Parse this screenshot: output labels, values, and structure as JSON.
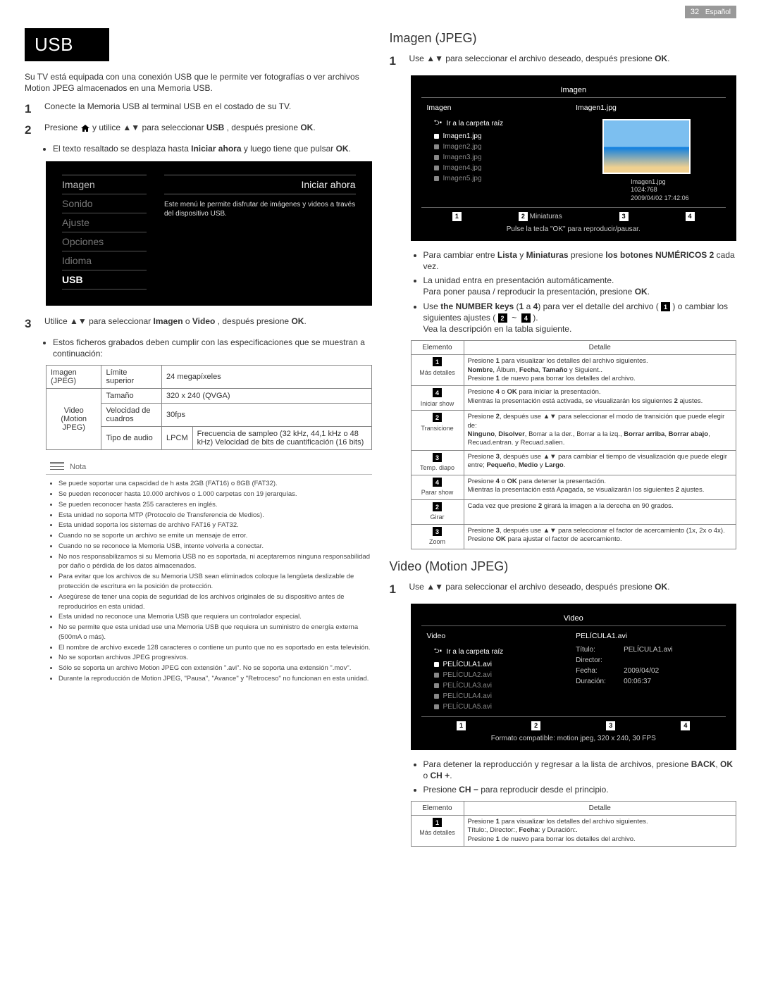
{
  "header": {
    "page": "32",
    "lang": "Español"
  },
  "left": {
    "title": "USB",
    "intro": "Su TV está equipada con una conexión USB que le permite ver fotografías o ver archivos Motion JPEG almacenados en una Memoria USB.",
    "step1": "Conecte la Memoria USB al terminal USB en el costado de su TV.",
    "step2_pre": "Presione ",
    "step2_mid": " y utilice ",
    "step2_post": " para seleccionar ",
    "step2_usb_bold": "USB",
    "step2_after": ", después presione ",
    "step2_ok": "OK",
    "step2_dot": ".",
    "bullet1_pre": "El texto resaltado se desplaza hasta ",
    "bullet1_bold": "Iniciar ahora",
    "bullet1_post": " y luego tiene que pulsar ",
    "bullet1_ok": "OK",
    "bullet1_dot": ".",
    "tv_menu": [
      "Imagen",
      "Sonido",
      "Ajuste",
      "Opciones",
      "Idioma",
      "USB"
    ],
    "tv_caption": "Este menú le permite disfrutar de imágenes y videos a través del dispositivo USB.",
    "tv_iniciar": "Iniciar ahora",
    "step3_pre": "Utilice ",
    "step3_mid": " para seleccionar ",
    "step3_b1": "Imagen",
    "step3_or": " o ",
    "step3_b2": "Video",
    "step3_post": ", después presione ",
    "step3_ok": "OK",
    "step3_dot": ".",
    "bullet2": "Estos ficheros grabados deben cumplir con las especificaciones que se muestran a continuación:",
    "spec": {
      "r1c1": "Imagen (JPEG)",
      "r1c2": "Límite superior",
      "r1c3": "24 megapíxeles",
      "r2c1": "Video (Motion JPEG)",
      "r2c2": "Tamaño",
      "r2c3": "320 x 240 (QVGA)",
      "r3c2": "Velocidad de cuadros",
      "r3c3": "30fps",
      "r4c2": "Tipo de audio",
      "r4c3a": "LPCM",
      "r4c3b": "Frecuencia de sampleo (32 kHz, 44,1 kHz o 48 kHz) Velocidad de bits de cuantificación (16 bits)"
    },
    "note_title": "Nota",
    "notes": [
      "Se puede soportar una capacidad de h asta 2GB (FAT16) o 8GB (FAT32).",
      "Se pueden reconocer hasta 10.000 archivos o 1.000 carpetas con 19 jerarquías.",
      "Se pueden reconocer hasta 255 caracteres en inglés.",
      "Esta unidad no soporta MTP (Protocolo de Transferencia de Medios).",
      "Esta unidad soporta los sistemas de archivo FAT16 y FAT32.",
      "Cuando no se soporte un archivo se emite un mensaje de error.",
      "Cuando no se reconoce la Memoria USB, intente volverla a conectar.",
      "No nos responsabilizamos si su Memoria USB no es soportada, ni aceptaremos ninguna responsabilidad por daño o pérdida de los datos almacenados.",
      "Para evitar que los archivos de su Memoria USB sean eliminados coloque la lengüeta deslizable de protección de escritura en la posición de protección.",
      "Asegúrese de tener una copia de seguridad de los archivos originales de su dispositivo antes de reproducirlos en esta unidad.",
      "Esta unidad no reconoce una Memoria USB que requiera un controlador especial.",
      "No se permite que esta unidad use una Memoria USB que requiera un suministro de energía externa (500mA o más).",
      "El nombre de archivo excede 128 caracteres o contiene un punto que no es soportado en esta televisión.",
      "No se soportan archivos JPEG progresivos.",
      "Sólo se soporta un archivo Motion JPEG con extensión \".avi\". No se soporta una extensión \".mov\".",
      "Durante la reproducción de Motion JPEG, \"Pausa\", \"Avance\" y \"Retroceso\" no funcionan en esta unidad."
    ]
  },
  "right": {
    "imagen_title": "Imagen (JPEG)",
    "imagen_step1": "Use ▲▼ para seleccionar el archivo deseado, después presione OK.",
    "img_browser": {
      "title": "Imagen",
      "col1_hdr": "Imagen",
      "col2_hdr": "Imagen1.jpg",
      "root": "Ir a la carpeta raíz",
      "files": [
        "Imagen1.jpg",
        "Imagen2.jpg",
        "Imagen3.jpg",
        "Imagen4.jpg",
        "Imagen5.jpg"
      ],
      "meta1": "Imagen1.jpg",
      "meta2": "1024:768",
      "meta3": "2009/04/02  17:42:06",
      "miniaturas": "Miniaturas",
      "hint": "Pulse la tecla \"OK\" para reproducir/pausar."
    },
    "imagen_bullets": [
      [
        "Para cambiar entre ",
        "Lista",
        " y ",
        "Miniaturas",
        " presione ",
        "los botones NUMÉRICOS 2",
        " cada vez."
      ],
      [
        "La unidad entra en presentación automáticamente.\nPara poner pausa / reproducir la presentación, presione ",
        "OK",
        "."
      ],
      [
        "Use ",
        "the NUMBER keys",
        " (",
        "1",
        " a ",
        "4",
        ") para ver el detalle del archivo (  1  ) o cambiar los siguientes ajustes (  2  ~  4  ).\nVea la descripción en la tabla siguiente."
      ]
    ],
    "detail_hdr_el": "Elemento",
    "detail_hdr_det": "Detalle",
    "imagen_detail": [
      {
        "n": "1",
        "lbl": "Más detalles",
        "txt": "Presione 1 para visualizar los detalles del archivo siguientes.\nNombre, Álbum, Fecha, Tamaño y Siguient..\nPresione 1 de nuevo para borrar los detalles del archivo."
      },
      {
        "n": "4",
        "lbl": "Iniciar show",
        "txt": "Presione 4 o OK para iniciar la presentación.\nMientras la presentación está activada, se visualizarán los siguientes 2 ajustes."
      },
      {
        "n": "2",
        "lbl": "Transicione",
        "txt": "Presione 2, después use ▲▼ para seleccionar el modo de transición que puede elegir de:\nNinguno, Disolver, Borrar a la der., Borrar a la izq., Borrar arriba, Borrar abajo, Recuad.entran. y Recuad.salien."
      },
      {
        "n": "3",
        "lbl": "Temp. diapo",
        "txt": "Presione 3, después use ▲▼ para cambiar el tiempo de visualización que puede elegir entre; Pequeño, Medio y Largo."
      },
      {
        "n": "4",
        "lbl": "Parar show",
        "txt": "Presione 4 o OK para detener la presentación.\nMientras la presentación está Apagada, se visualizarán los siguientes 2 ajustes."
      },
      {
        "n": "2",
        "lbl": "Girar",
        "txt": "Cada vez que presione 2 girará la imagen a la derecha en 90 grados."
      },
      {
        "n": "3",
        "lbl": "Zoom",
        "txt": "Presione 3, después use ▲▼ para seleccionar el factor de acercamiento (1x, 2x o 4x). Presione OK para ajustar el factor de acercamiento."
      }
    ],
    "video_title": "Video (Motion JPEG)",
    "video_step1": "Use ▲▼ para seleccionar el archivo deseado, después presione OK.",
    "vid_browser": {
      "title": "Video",
      "col1_hdr": "Video",
      "col2_hdr": "PELÍCULA1.avi",
      "root": "Ir a la carpeta raíz",
      "files": [
        "PELÍCULA1.avi",
        "PELÍCULA2.avi",
        "PELÍCULA3.avi",
        "PELÍCULA4.avi",
        "PELÍCULA5.avi"
      ],
      "info_t": "Título:",
      "info_tv": "PELÍCULA1.avi",
      "info_d": "Director:",
      "info_f": "Fecha:",
      "info_fv": "2009/04/02",
      "info_du": "Duración:",
      "info_duv": "00:06:37",
      "hint": "Formato compatible:  motion jpeg,  320 x 240,  30 FPS"
    },
    "video_bullets": [
      [
        "Para detener la reproducción y regresar a la lista de archivos, presione ",
        "BACK",
        ", ",
        "OK",
        " o ",
        "CH +",
        "."
      ],
      [
        "Presione ",
        "CH −",
        " para reproducir desde el principio."
      ]
    ],
    "video_detail": [
      {
        "n": "1",
        "lbl": "Más detalles",
        "txt": "Presione 1 para visualizar los detalles del archivo siguientes.\nTítulo:, Director:, Fecha: y Duración:.\nPresione 1 de nuevo para borrar los detalles del archivo."
      }
    ]
  }
}
